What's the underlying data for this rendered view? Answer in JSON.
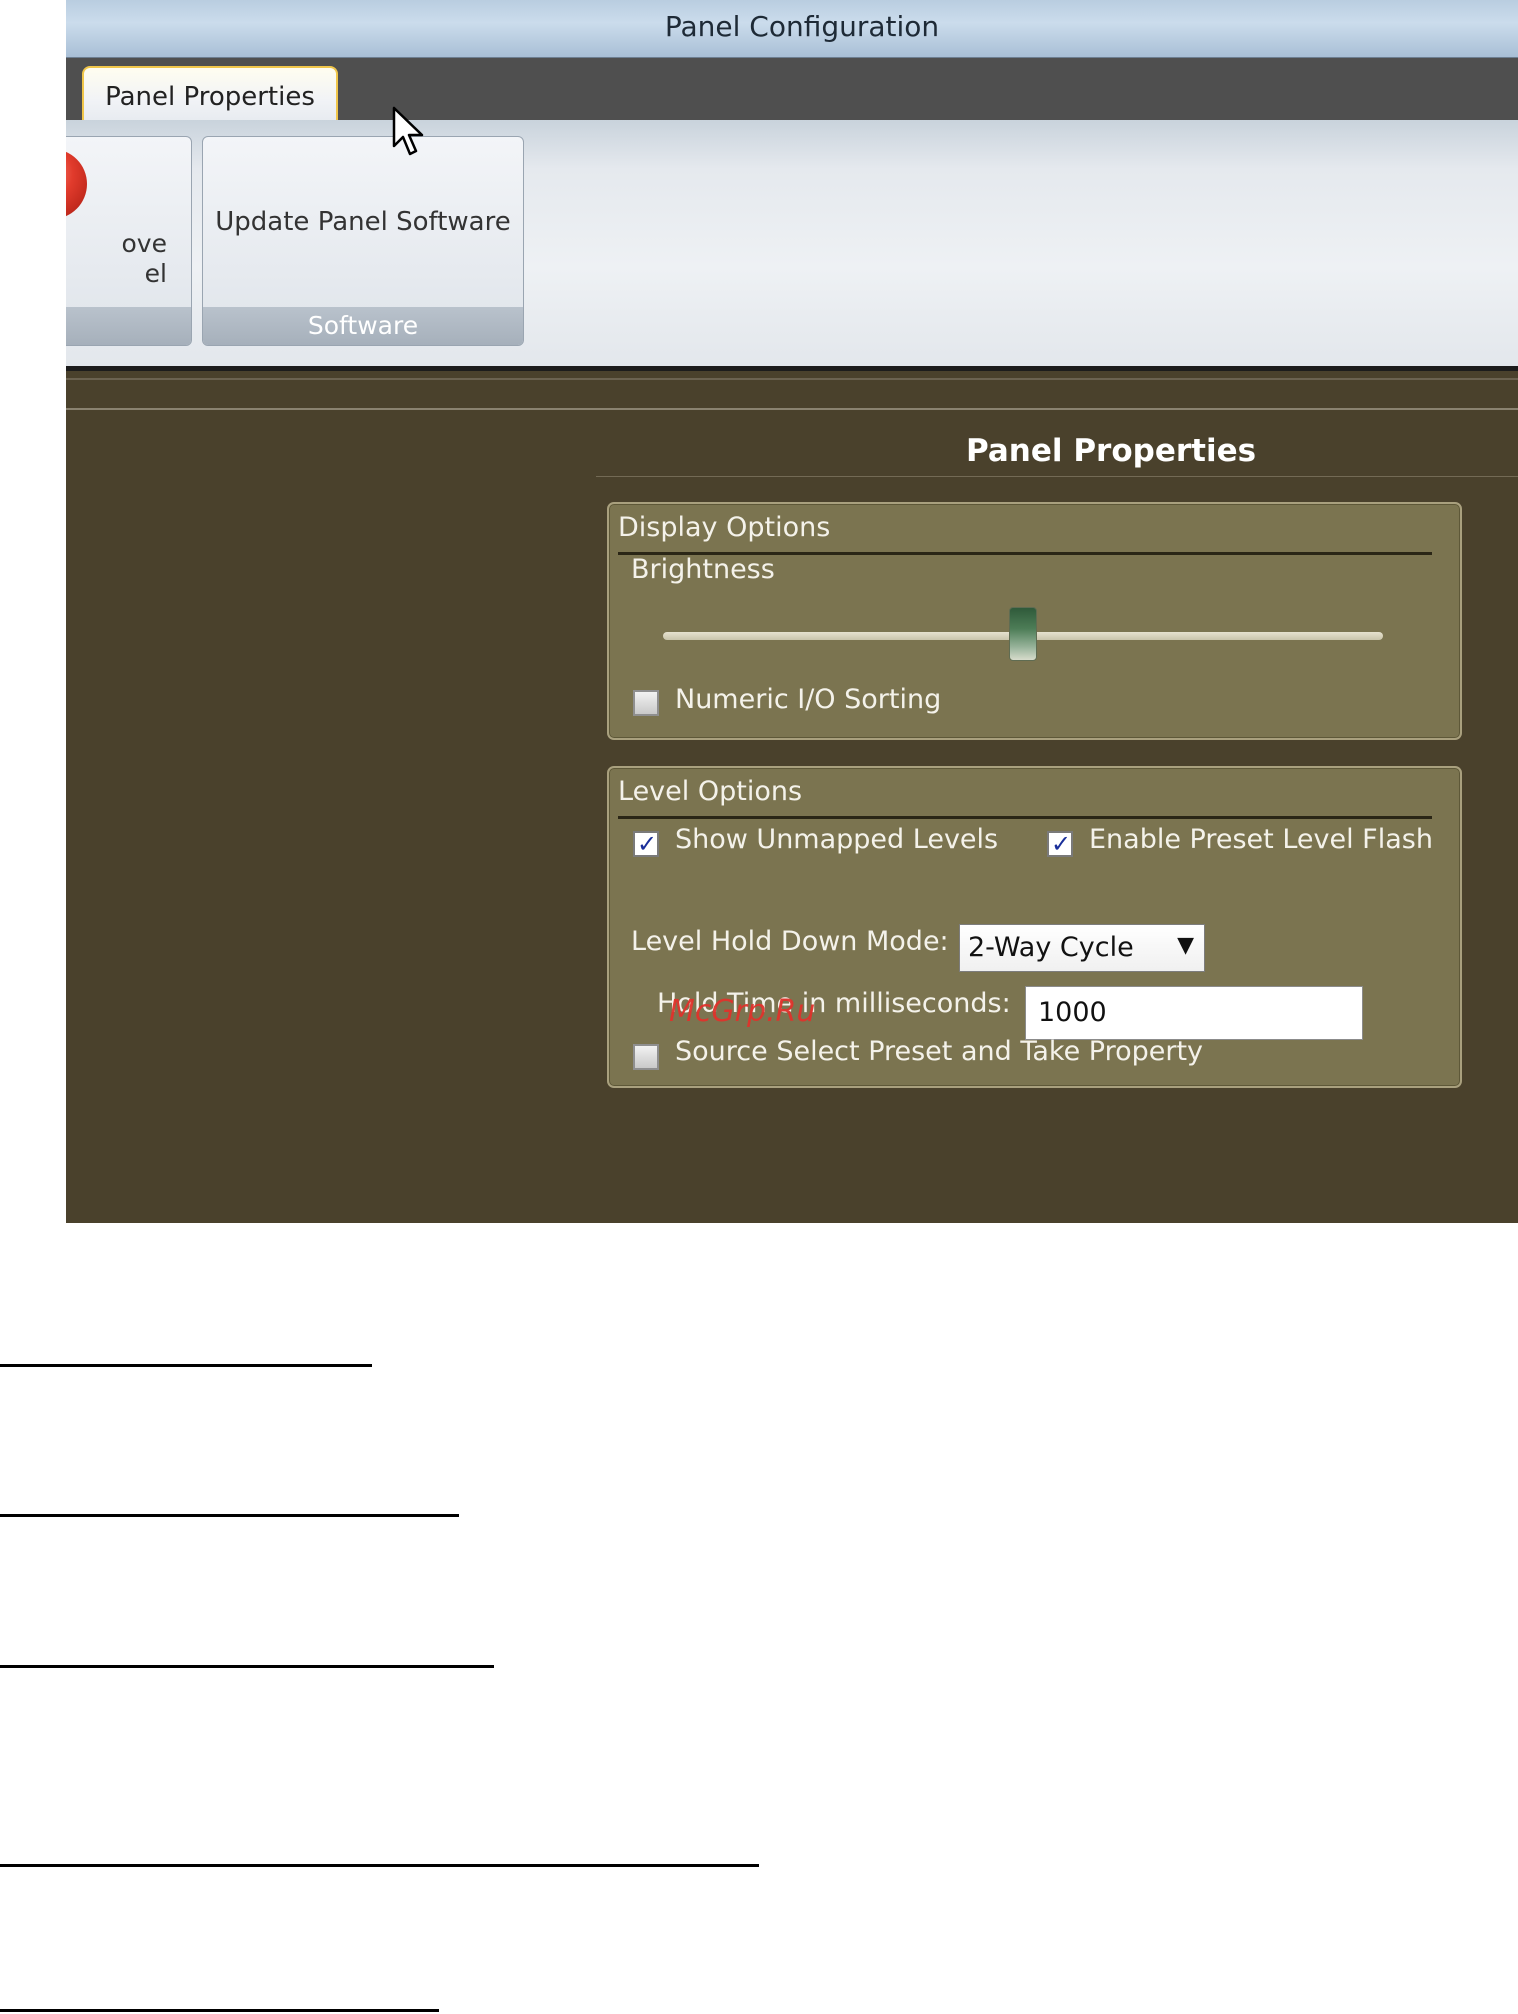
{
  "window": {
    "title": "Panel Configuration"
  },
  "ribbon": {
    "tab": "Panel Properties",
    "left_group_partial_label_lines": [
      "ove",
      "el"
    ],
    "update_button": "Update Panel Software",
    "software_group_label": "Software"
  },
  "panel": {
    "title": "Panel Properties"
  },
  "display_options": {
    "legend": "Display Options",
    "brightness_label": "Brightness",
    "brightness_value": 0.5,
    "numeric_sorting_label": "Numeric I/O Sorting",
    "numeric_sorting_checked": false
  },
  "level_options": {
    "legend": "Level Options",
    "show_unmapped_label": "Show Unmapped Levels",
    "show_unmapped_checked": true,
    "enable_flash_label": "Enable Preset Level Flash",
    "enable_flash_checked": true,
    "hold_down_mode_label": "Level Hold Down Mode:",
    "hold_down_mode_value": "2-Way Cycle",
    "hold_time_label": "Hold Time in milliseconds:",
    "hold_time_value": "1000",
    "source_select_label": "Source Select Preset and Take Property",
    "source_select_checked": false
  },
  "watermark": "McGrp.Ru",
  "icons": {
    "remove": "remove-panel-icon",
    "dropdown": "chevron-down-icon",
    "cursor": "mouse-cursor-icon"
  },
  "colors": {
    "panel_bg": "#4a412c",
    "groupbox_bg": "#7b7450",
    "tab_border": "#f0c64a"
  }
}
